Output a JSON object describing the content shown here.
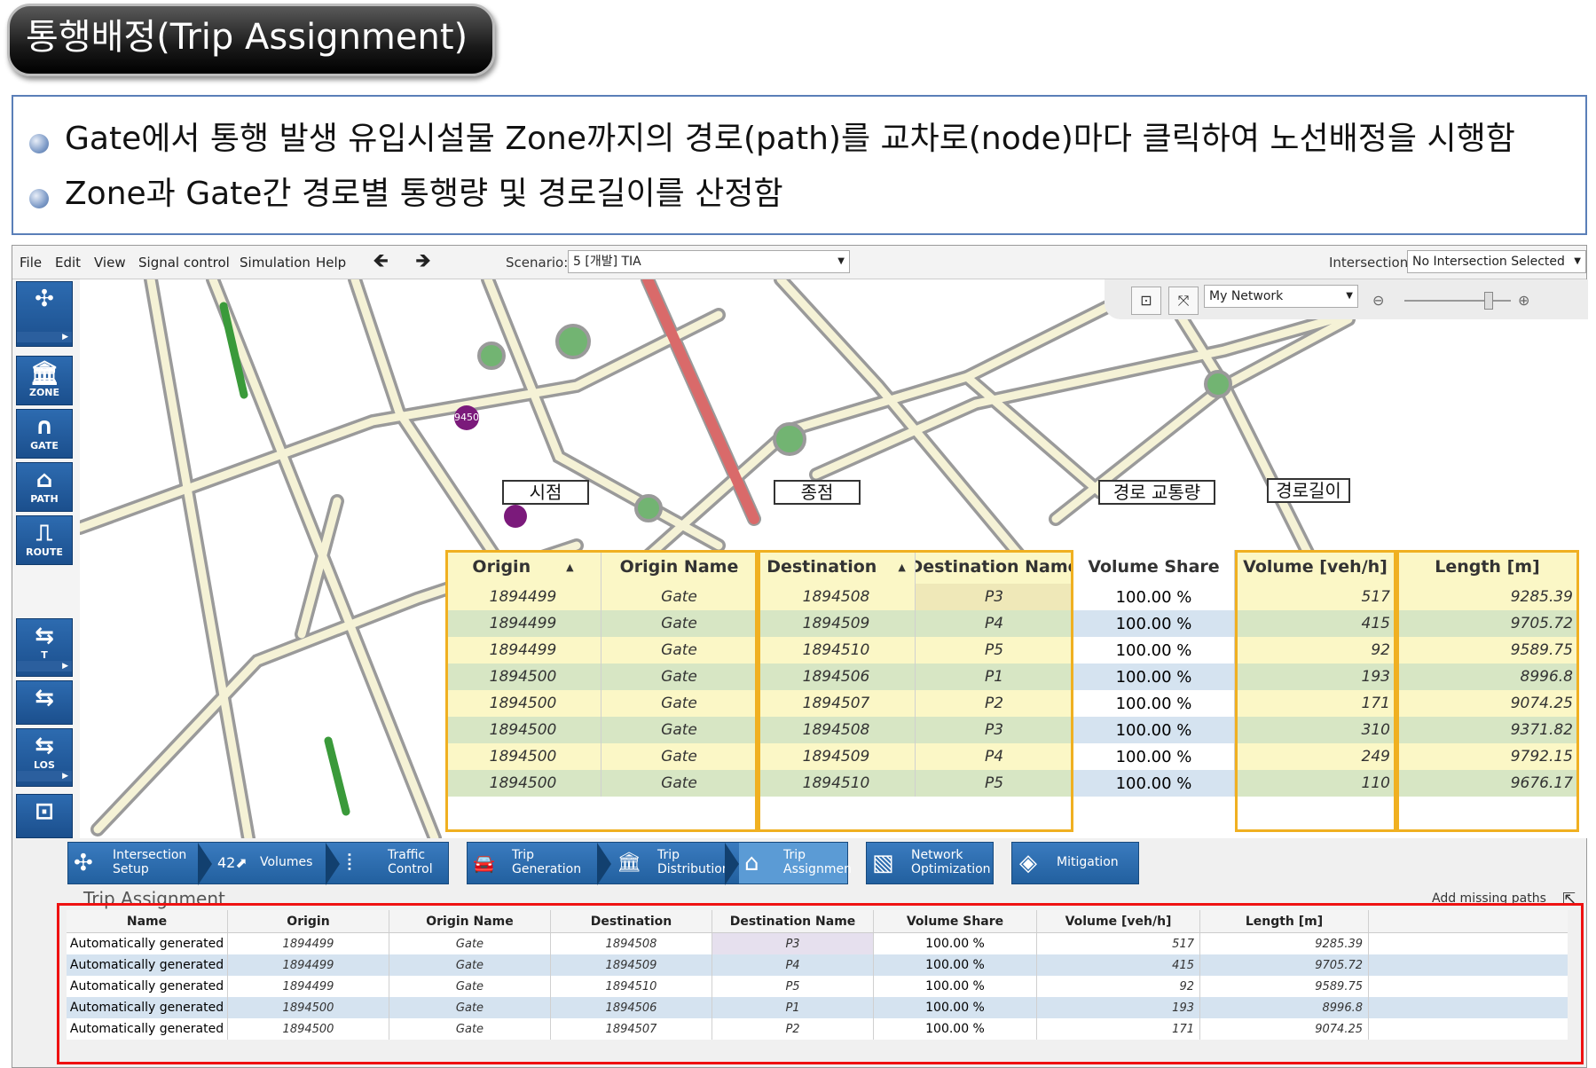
{
  "title": "통행배정(Trip Assignment)",
  "bullets": [
    "Gate에서 통행 발생 유입시설물 Zone까지의 경로(path)를 교차로(node)마다 클릭하여 노선배정을 시행함",
    "Zone과 Gate간 경로별 통행량 및 경로길이를 산정함"
  ],
  "menu": [
    "File",
    "Edit",
    "View",
    "Signal control",
    "Simulation",
    "Help"
  ],
  "nav": {
    "back": "🡸",
    "forward": "🡺"
  },
  "scenario": {
    "label": "Scenario:",
    "value": "5 [개발] TIA"
  },
  "intersection": {
    "label": "Intersection:",
    "value": "No Intersection Selected"
  },
  "map_controls": {
    "network": "My Network",
    "minus": "⊖",
    "plus": "⊕"
  },
  "left_toolbar": [
    {
      "icon": "intersection-icon",
      "glyph": "✣",
      "label": ""
    },
    {
      "icon": "zone-icon",
      "glyph": "🏛",
      "label": "ZONE"
    },
    {
      "icon": "gate-icon",
      "glyph": "∩",
      "label": "GATE"
    },
    {
      "icon": "path-icon",
      "glyph": "⌂",
      "label": "PATH"
    },
    {
      "icon": "route-icon",
      "glyph": "⎍",
      "label": "ROUTE"
    },
    {
      "icon": "turn-icon",
      "glyph": "⇆",
      "label": "T"
    },
    {
      "icon": "signal-icon",
      "glyph": "⇆",
      "label": ""
    },
    {
      "icon": "los-icon",
      "glyph": "⇆",
      "label": "LOS"
    },
    {
      "icon": "node-icon",
      "glyph": "⊡",
      "label": ""
    }
  ],
  "map_markers": [
    "9450",
    ""
  ],
  "annotations": {
    "origin": "시점",
    "destination": "종점",
    "volume": "경로 교통량",
    "length": "경로길이"
  },
  "big_table": {
    "headers": [
      "Origin",
      "Origin Name",
      "Destination",
      "Destination Name",
      "Volume Share",
      "Volume [veh/h]",
      "Length [m]"
    ],
    "sort_asc": "▲",
    "rows": [
      [
        "1894499",
        "Gate",
        "1894508",
        "P3",
        "100.00 %",
        "517",
        "9285.39"
      ],
      [
        "1894499",
        "Gate",
        "1894509",
        "P4",
        "100.00 %",
        "415",
        "9705.72"
      ],
      [
        "1894499",
        "Gate",
        "1894510",
        "P5",
        "100.00 %",
        "92",
        "9589.75"
      ],
      [
        "1894500",
        "Gate",
        "1894506",
        "P1",
        "100.00 %",
        "193",
        "8996.8"
      ],
      [
        "1894500",
        "Gate",
        "1894507",
        "P2",
        "100.00 %",
        "171",
        "9074.25"
      ],
      [
        "1894500",
        "Gate",
        "1894508",
        "P3",
        "100.00 %",
        "310",
        "9371.82"
      ],
      [
        "1894500",
        "Gate",
        "1894509",
        "P4",
        "100.00 %",
        "249",
        "9792.15"
      ],
      [
        "1894500",
        "Gate",
        "1894510",
        "P5",
        "100.00 %",
        "110",
        "9676.17"
      ]
    ]
  },
  "workflow": [
    {
      "icon": "intersection-setup-icon",
      "glyph": "✣",
      "line1": "Intersection",
      "line2": "Setup"
    },
    {
      "icon": "volumes-icon",
      "glyph": "42⬈",
      "line1": "Volumes",
      "line2": ""
    },
    {
      "icon": "traffic-control-icon",
      "glyph": "⦙",
      "line1": "Traffic",
      "line2": "Control"
    },
    {
      "icon": "trip-generation-icon",
      "glyph": "🚘",
      "line1": "Trip",
      "line2": "Generation"
    },
    {
      "icon": "trip-distribution-icon",
      "glyph": "🏛",
      "line1": "Trip",
      "line2": "Distribution"
    },
    {
      "icon": "trip-assignment-icon",
      "glyph": "⌂",
      "line1": "Trip",
      "line2": "Assignmen"
    },
    {
      "icon": "network-optimization-icon",
      "glyph": "▧",
      "line1": "Network",
      "line2": "Optimization"
    },
    {
      "icon": "mitigation-icon",
      "glyph": "◈",
      "line1": "Mitigation",
      "line2": ""
    }
  ],
  "panel": {
    "title": "Trip Assignment",
    "add_missing": "Add missing paths",
    "headers": [
      "Name",
      "Origin",
      "Origin Name",
      "Destination",
      "Destination Name",
      "Volume Share",
      "Volume [veh/h]",
      "Length [m]"
    ],
    "rows": [
      [
        "Automatically generated",
        "1894499",
        "Gate",
        "1894508",
        "P3",
        "100.00 %",
        "517",
        "9285.39"
      ],
      [
        "Automatically generated",
        "1894499",
        "Gate",
        "1894509",
        "P4",
        "100.00 %",
        "415",
        "9705.72"
      ],
      [
        "Automatically generated",
        "1894499",
        "Gate",
        "1894510",
        "P5",
        "100.00 %",
        "92",
        "9589.75"
      ],
      [
        "Automatically generated",
        "1894500",
        "Gate",
        "1894506",
        "P1",
        "100.00 %",
        "193",
        "8996.8"
      ],
      [
        "Automatically generated",
        "1894500",
        "Gate",
        "1894507",
        "P2",
        "100.00 %",
        "171",
        "9074.25"
      ]
    ]
  },
  "colors": {
    "accent_blue": "#22609f",
    "highlight_yellow": "#f0b021",
    "red_box": "#e11111",
    "row_yellow": "#fbf7c6",
    "row_green": "#d7e6c4",
    "row_blue": "#d5e3f0"
  }
}
